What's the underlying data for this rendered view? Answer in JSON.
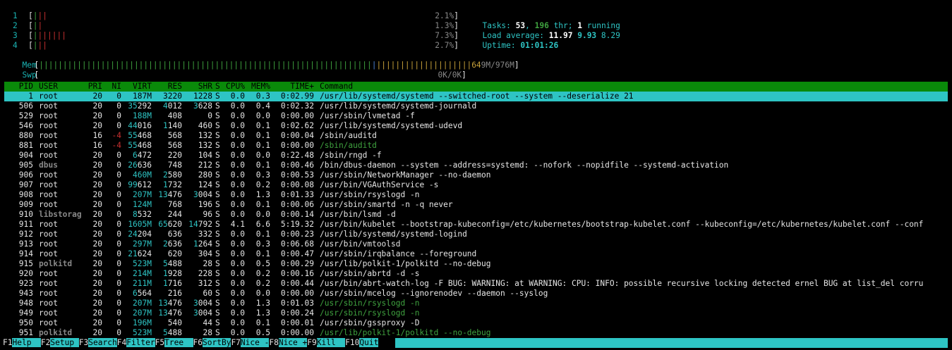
{
  "cpus": [
    {
      "label": "1",
      "bars": "|||",
      "bar_colors": [
        "green",
        "red",
        "red"
      ],
      "percent": "2.1%"
    },
    {
      "label": "2",
      "bars": "||",
      "bar_colors": [
        "green",
        "red"
      ],
      "percent": "1.3%"
    },
    {
      "label": "3",
      "bars": "|||||||",
      "bar_colors": [
        "green",
        "red",
        "red",
        "red",
        "red",
        "red",
        "red"
      ],
      "percent": "7.3%"
    },
    {
      "label": "4",
      "bars": "|||",
      "bar_colors": [
        "green",
        "red",
        "red"
      ],
      "percent": "2.7%"
    }
  ],
  "mem": {
    "label": "Mem",
    "green_bars": "||||||||||||||||||||||||||||||||||||||||||||||||||||||||||||||||||||||",
    "blue_bars": "|",
    "yellow_bars": "||||||||||||||||||||",
    "value_prefix": "64",
    "value_rest": "9M/976M"
  },
  "swp": {
    "label": "Swp",
    "value": "0K/0K"
  },
  "stats": {
    "tasks_label": "Tasks: ",
    "tasks": "53",
    "thr_sep": ", ",
    "threads": "196",
    "thr_label": " thr; ",
    "running": "1",
    "running_label": " running",
    "load_label": "Load average: ",
    "load1": "11.97",
    "load5": "9.93",
    "load15": "8.29",
    "uptime_label": "Uptime: ",
    "uptime": "01:01:26"
  },
  "columns": {
    "pid": "PID",
    "user": "USER",
    "pri": "PRI",
    "ni": "NI",
    "virt": "VIRT",
    "res": "RES",
    "shr": "SHR",
    "s": "S",
    "cpu": "CPU%",
    "mem": "MEM%",
    "time": "TIME+",
    "command": "Command"
  },
  "processes": [
    {
      "pid": "1",
      "user": "root",
      "pri": "20",
      "ni": "0",
      "virt": "187M",
      "res": "3220",
      "shr": "1228",
      "s": "S",
      "cpu": "0.0",
      "mem": "0.3",
      "time": "0:02.99",
      "command": "/usr/lib/systemd/systemd --switched-root --system --deserialize 21",
      "selected": true
    },
    {
      "pid": "506",
      "user": "root",
      "pri": "20",
      "ni": "0",
      "virt": "35292",
      "res": "4012",
      "shr": "3628",
      "s": "S",
      "cpu": "0.0",
      "mem": "0.4",
      "time": "0:02.32",
      "command": "/usr/lib/systemd/systemd-journald"
    },
    {
      "pid": "529",
      "user": "root",
      "pri": "20",
      "ni": "0",
      "virt": "188M",
      "res": "408",
      "shr": "0",
      "s": "S",
      "cpu": "0.0",
      "mem": "0.0",
      "time": "0:00.00",
      "command": "/usr/sbin/lvmetad -f"
    },
    {
      "pid": "546",
      "user": "root",
      "pri": "20",
      "ni": "0",
      "virt": "44016",
      "res": "1140",
      "shr": "460",
      "s": "S",
      "cpu": "0.0",
      "mem": "0.1",
      "time": "0:02.62",
      "command": "/usr/lib/systemd/systemd-udevd"
    },
    {
      "pid": "880",
      "user": "root",
      "pri": "16",
      "ni": "-4",
      "virt": "55468",
      "res": "568",
      "shr": "132",
      "s": "S",
      "cpu": "0.0",
      "mem": "0.1",
      "time": "0:00.04",
      "command": "/sbin/auditd"
    },
    {
      "pid": "881",
      "user": "root",
      "pri": "16",
      "ni": "-4",
      "virt": "55468",
      "res": "568",
      "shr": "132",
      "s": "S",
      "cpu": "0.0",
      "mem": "0.1",
      "time": "0:00.00",
      "command": "/sbin/auditd",
      "thread": true
    },
    {
      "pid": "904",
      "user": "root",
      "pri": "20",
      "ni": "0",
      "virt": "6472",
      "res": "220",
      "shr": "104",
      "s": "S",
      "cpu": "0.0",
      "mem": "0.0",
      "time": "0:22.48",
      "command": "/sbin/rngd -f"
    },
    {
      "pid": "905",
      "user": "dbus",
      "pri": "20",
      "ni": "0",
      "virt": "26636",
      "res": "748",
      "shr": "212",
      "s": "S",
      "cpu": "0.0",
      "mem": "0.1",
      "time": "0:00.46",
      "command": "/bin/dbus-daemon --system --address=systemd: --nofork --nopidfile --systemd-activation",
      "dim_user": true
    },
    {
      "pid": "906",
      "user": "root",
      "pri": "20",
      "ni": "0",
      "virt": "460M",
      "res": "2580",
      "shr": "280",
      "s": "S",
      "cpu": "0.0",
      "mem": "0.3",
      "time": "0:00.53",
      "command": "/usr/sbin/NetworkManager --no-daemon"
    },
    {
      "pid": "907",
      "user": "root",
      "pri": "20",
      "ni": "0",
      "virt": "99612",
      "res": "1732",
      "shr": "124",
      "s": "S",
      "cpu": "0.0",
      "mem": "0.2",
      "time": "0:00.08",
      "command": "/usr/bin/VGAuthService -s"
    },
    {
      "pid": "908",
      "user": "root",
      "pri": "20",
      "ni": "0",
      "virt": "207M",
      "res": "13476",
      "shr": "3004",
      "s": "S",
      "cpu": "0.0",
      "mem": "1.3",
      "time": "0:01.33",
      "command": "/usr/sbin/rsyslogd -n"
    },
    {
      "pid": "909",
      "user": "root",
      "pri": "20",
      "ni": "0",
      "virt": "124M",
      "res": "768",
      "shr": "196",
      "s": "S",
      "cpu": "0.0",
      "mem": "0.1",
      "time": "0:00.06",
      "command": "/usr/sbin/smartd -n -q never"
    },
    {
      "pid": "910",
      "user": "libstorag",
      "pri": "20",
      "ni": "0",
      "virt": "8532",
      "res": "244",
      "shr": "96",
      "s": "S",
      "cpu": "0.0",
      "mem": "0.0",
      "time": "0:00.14",
      "command": "/usr/bin/lsmd -d",
      "dim_user": true
    },
    {
      "pid": "911",
      "user": "root",
      "pri": "20",
      "ni": "0",
      "virt": "1605M",
      "res": "65620",
      "shr": "14792",
      "s": "S",
      "cpu": "4.1",
      "mem": "6.6",
      "time": "5:19.32",
      "command": "/usr/bin/kubelet --bootstrap-kubeconfig=/etc/kubernetes/bootstrap-kubelet.conf --kubeconfig=/etc/kubernetes/kubelet.conf --conf"
    },
    {
      "pid": "912",
      "user": "root",
      "pri": "20",
      "ni": "0",
      "virt": "24204",
      "res": "636",
      "shr": "332",
      "s": "S",
      "cpu": "0.0",
      "mem": "0.1",
      "time": "0:00.23",
      "command": "/usr/lib/systemd/systemd-logind"
    },
    {
      "pid": "913",
      "user": "root",
      "pri": "20",
      "ni": "0",
      "virt": "297M",
      "res": "2636",
      "shr": "1264",
      "s": "S",
      "cpu": "0.0",
      "mem": "0.3",
      "time": "0:06.68",
      "command": "/usr/bin/vmtoolsd"
    },
    {
      "pid": "914",
      "user": "root",
      "pri": "20",
      "ni": "0",
      "virt": "21624",
      "res": "620",
      "shr": "304",
      "s": "S",
      "cpu": "0.0",
      "mem": "0.1",
      "time": "0:00.47",
      "command": "/usr/sbin/irqbalance --foreground"
    },
    {
      "pid": "915",
      "user": "polkitd",
      "pri": "20",
      "ni": "0",
      "virt": "523M",
      "res": "5488",
      "shr": "28",
      "s": "S",
      "cpu": "0.0",
      "mem": "0.5",
      "time": "0:00.29",
      "command": "/usr/lib/polkit-1/polkitd --no-debug",
      "dim_user": true
    },
    {
      "pid": "920",
      "user": "root",
      "pri": "20",
      "ni": "0",
      "virt": "214M",
      "res": "1928",
      "shr": "228",
      "s": "S",
      "cpu": "0.0",
      "mem": "0.2",
      "time": "0:00.16",
      "command": "/usr/sbin/abrtd -d -s"
    },
    {
      "pid": "923",
      "user": "root",
      "pri": "20",
      "ni": "0",
      "virt": "211M",
      "res": "1716",
      "shr": "312",
      "s": "S",
      "cpu": "0.0",
      "mem": "0.2",
      "time": "0:00.44",
      "command": "/usr/bin/abrt-watch-log -F BUG: WARNING: at WARNING: CPU: INFO: possible recursive locking detected ernel BUG at list_del corru"
    },
    {
      "pid": "943",
      "user": "root",
      "pri": "20",
      "ni": "0",
      "virt": "6564",
      "res": "216",
      "shr": "60",
      "s": "S",
      "cpu": "0.0",
      "mem": "0.0",
      "time": "0:00.00",
      "command": "/usr/sbin/mcelog --ignorenodev --daemon --syslog"
    },
    {
      "pid": "948",
      "user": "root",
      "pri": "20",
      "ni": "0",
      "virt": "207M",
      "res": "13476",
      "shr": "3004",
      "s": "S",
      "cpu": "0.0",
      "mem": "1.3",
      "time": "0:01.03",
      "command": "/usr/sbin/rsyslogd -n",
      "thread": true
    },
    {
      "pid": "949",
      "user": "root",
      "pri": "20",
      "ni": "0",
      "virt": "207M",
      "res": "13476",
      "shr": "3004",
      "s": "S",
      "cpu": "0.0",
      "mem": "1.3",
      "time": "0:00.24",
      "command": "/usr/sbin/rsyslogd -n",
      "thread": true
    },
    {
      "pid": "950",
      "user": "root",
      "pri": "20",
      "ni": "0",
      "virt": "196M",
      "res": "540",
      "shr": "44",
      "s": "S",
      "cpu": "0.0",
      "mem": "0.1",
      "time": "0:00.01",
      "command": "/usr/sbin/gssproxy -D"
    },
    {
      "pid": "951",
      "user": "polkitd",
      "pri": "20",
      "ni": "0",
      "virt": "523M",
      "res": "5488",
      "shr": "28",
      "s": "S",
      "cpu": "0.0",
      "mem": "0.5",
      "time": "0:00.00",
      "command": "/usr/lib/polkit-1/polkitd --no-debug",
      "thread": true,
      "dim_user": true
    }
  ],
  "footer": [
    {
      "key": "F1",
      "label": "Help  "
    },
    {
      "key": "F2",
      "label": "Setup "
    },
    {
      "key": "F3",
      "label": "Search"
    },
    {
      "key": "F4",
      "label": "Filter"
    },
    {
      "key": "F5",
      "label": "Tree  "
    },
    {
      "key": "F6",
      "label": "SortBy"
    },
    {
      "key": "F7",
      "label": "Nice -"
    },
    {
      "key": "F8",
      "label": "Nice +"
    },
    {
      "key": "F9",
      "label": "Kill  "
    },
    {
      "key": "F10",
      "label": "Quit"
    }
  ],
  "colors": {
    "header_bg": "#0a8a0a",
    "selected_bg": "#2ec4c4",
    "meter_green": "#3fa23f",
    "meter_red": "#c83030",
    "meter_blue": "#4a7fd6",
    "meter_yellow": "#c8a23a"
  }
}
